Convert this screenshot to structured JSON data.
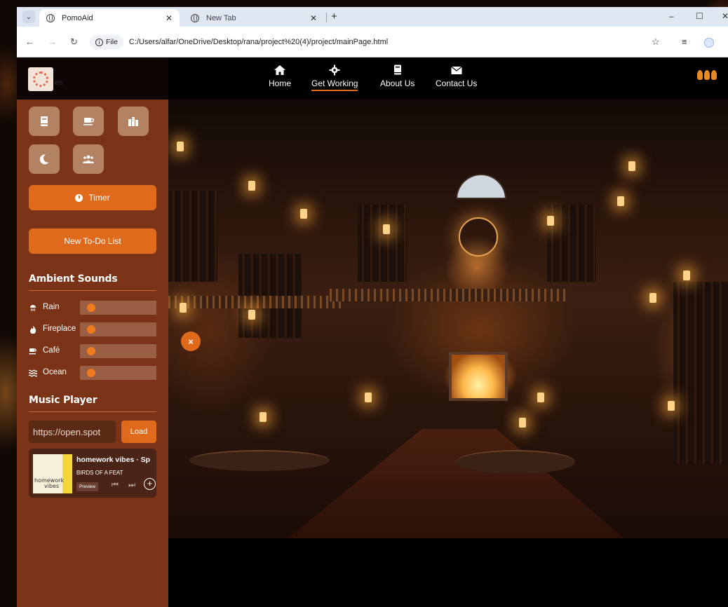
{
  "browser": {
    "tabs": [
      {
        "title": "PomoAid",
        "active": true
      },
      {
        "title": "New Tab",
        "active": false
      }
    ],
    "new_tab_symbol": "+",
    "window_controls": {
      "minimize": "–",
      "maximize": "☐",
      "close": "✕"
    },
    "address": {
      "info_label": "File",
      "url": "C:/Users/alfar/OneDrive/Desktop/rana/project%20(4)/project/mainPage.html"
    }
  },
  "logo": {
    "text": "es"
  },
  "nav": {
    "items": [
      {
        "label": "Home",
        "icon": "home-icon",
        "active": false
      },
      {
        "label": "Get Working",
        "icon": "gear-icon",
        "active": true
      },
      {
        "label": "About Us",
        "icon": "book-icon",
        "active": false
      },
      {
        "label": "Contact Us",
        "icon": "mail-icon",
        "active": false
      }
    ]
  },
  "sidebar": {
    "tools": [
      "book-icon",
      "coffee-icon",
      "city-icon",
      "moon-icon",
      "users-icon"
    ],
    "timer_label": "Timer",
    "todo_label": "New To-Do List",
    "ambient_title": "Ambient Sounds",
    "sounds": [
      {
        "label": "Rain",
        "icon": "rain-icon",
        "level": 0.1
      },
      {
        "label": "Fireplace",
        "icon": "fire-icon",
        "level": 0.1
      },
      {
        "label": "Café",
        "icon": "coffee-icon",
        "level": 0.1
      },
      {
        "label": "Ocean",
        "icon": "waves-icon",
        "level": 0.1
      }
    ],
    "music_title": "Music Player",
    "music_input_value": "https://open.spot",
    "load_label": "Load",
    "spotify": {
      "title": "homework vibes · Sp",
      "artist": "BIRDS OF A FEAT",
      "preview_label": "Preview",
      "cover_text_1": "homework",
      "cover_text_2": "vibes"
    }
  },
  "close_fab_label": "×",
  "colors": {
    "accent": "#e06a1c",
    "sidebar_bg": "#7a3316",
    "tool_bg": "#b28262"
  }
}
